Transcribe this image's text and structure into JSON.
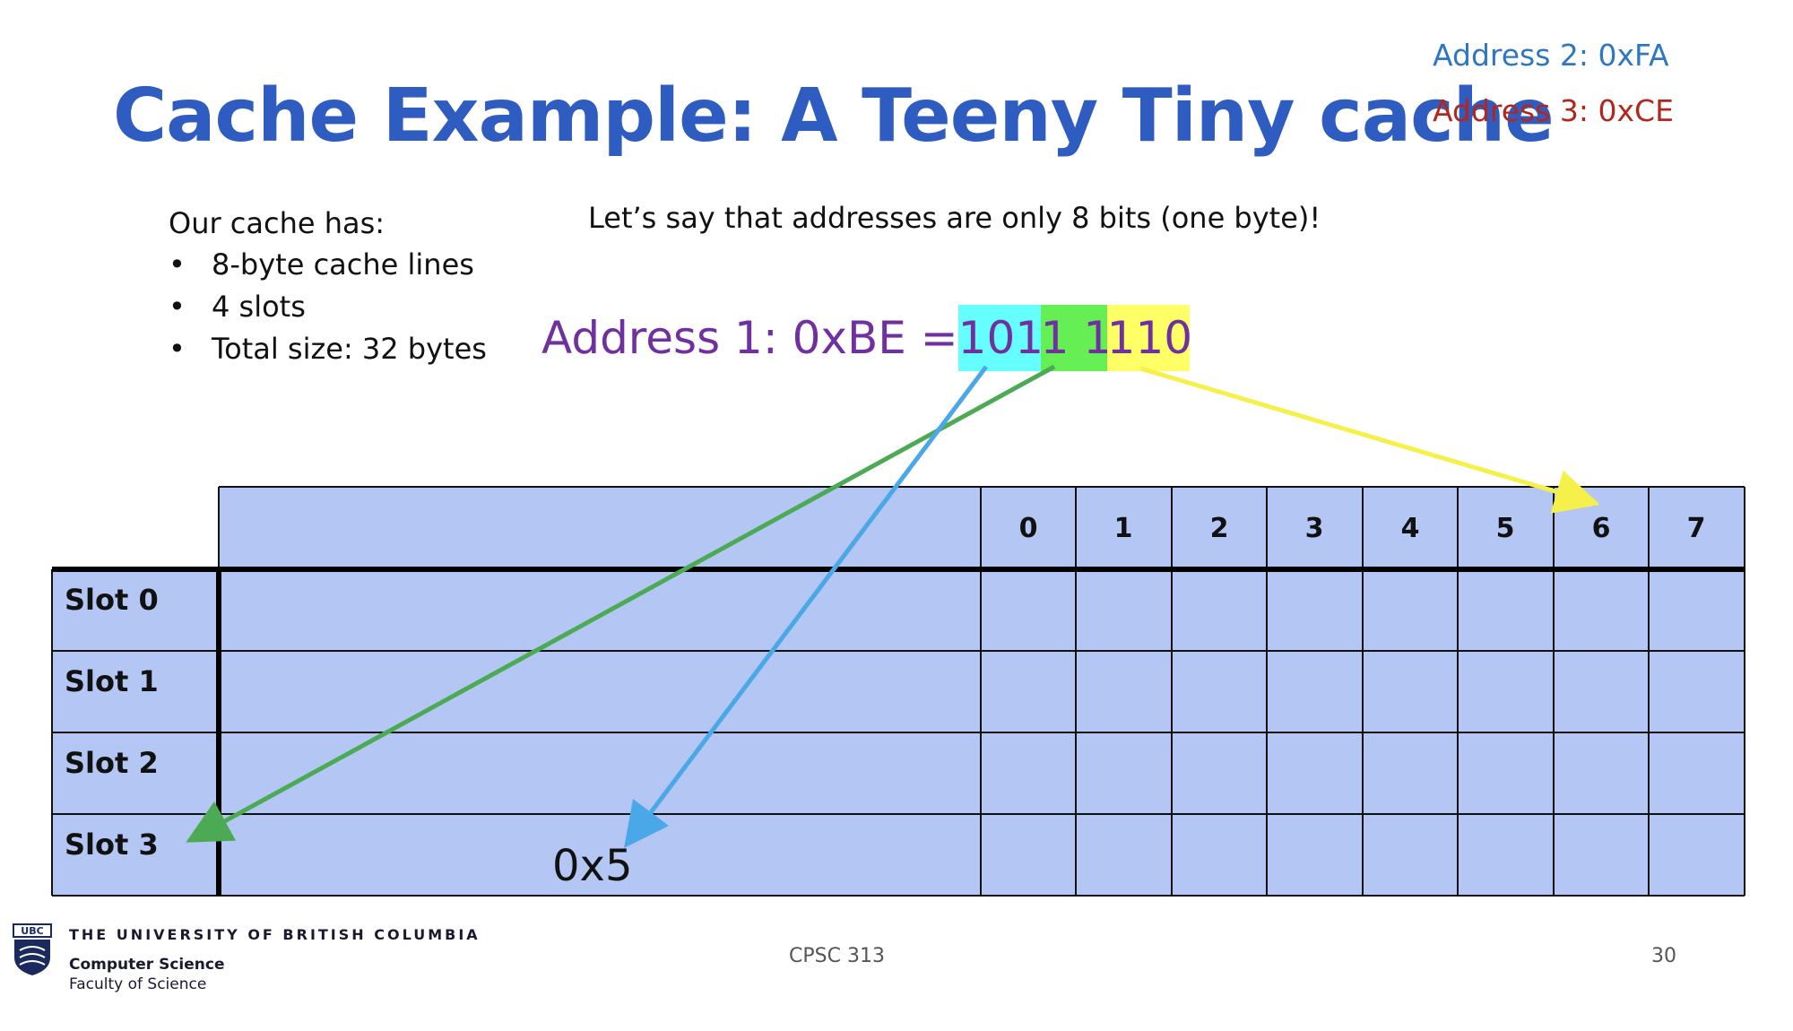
{
  "slide": {
    "title": "Cache Example: A Teeny Tiny cache",
    "address2": "Address 2: 0xFA",
    "address3": "Address 3: 0xCE",
    "cache_intro": "Our cache has:",
    "cache_specs": [
      "8-byte cache lines",
      "4 slots",
      "Total size: 32 bytes"
    ],
    "bullet_char": "•",
    "address_note": "Let’s say that addresses are only 8 bits (one byte)!",
    "address1": {
      "label": "Address 1: 0xBE = ",
      "tag_bits": "101",
      "index_bits": "1 1",
      "offset_bits": "110"
    },
    "colors": {
      "title": "#2f5cc0",
      "address2": "#2e77c3",
      "address3": "#b3261e",
      "address1": "#7030a0",
      "tag_highlight": "#66ffff",
      "index_highlight": "#66ee55",
      "offset_highlight": "#ffff66",
      "table_fill": "#b4c7f4",
      "arrow_index": "#4caa55",
      "arrow_tag": "#4aa8e8",
      "arrow_offset": "#f5f04a"
    }
  },
  "cache_table": {
    "byte_columns": [
      "0",
      "1",
      "2",
      "3",
      "4",
      "5",
      "6",
      "7"
    ],
    "slots": [
      "Slot 0",
      "Slot 1",
      "Slot 2",
      "Slot 3"
    ],
    "slot3_tag": "0x5"
  },
  "footer": {
    "institution": "THE UNIVERSITY OF BRITISH COLUMBIA",
    "department": "Computer Science",
    "faculty": "Faculty of Science",
    "logo_text": "UBC",
    "course": "CPSC 313",
    "page_number": "30"
  }
}
